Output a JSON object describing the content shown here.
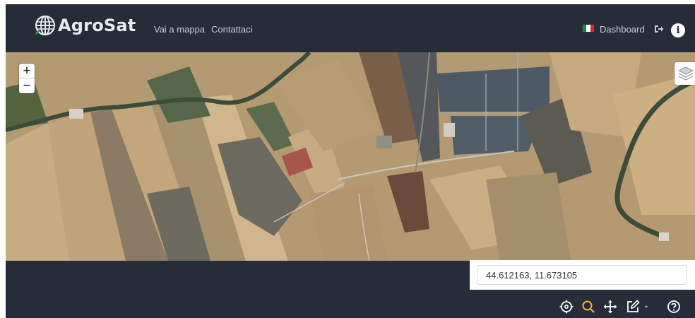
{
  "app": {
    "brand": "AgroSat"
  },
  "nav": {
    "mappa": "Vai a mappa",
    "contatti": "Contattaci",
    "dashboard": "Dashboard"
  },
  "colors": {
    "header_bg": "#262c38",
    "accent_search": "#f0b43a",
    "flag": [
      "#009246",
      "#ffffff",
      "#ce2b37"
    ]
  },
  "map": {
    "zoom_in": "+",
    "zoom_out": "−"
  },
  "coordinates": {
    "value": "44.612163, 11.673105"
  },
  "icons": {
    "brand": "globe-icon",
    "flag": "italy-flag-icon",
    "logout": "logout-icon",
    "info": "info-icon",
    "layers": "layers-icon",
    "tools": [
      "crosshair-icon",
      "search-icon",
      "move-icon",
      "edit-icon",
      "caret-up-icon",
      "help-icon"
    ]
  },
  "info_label": "i"
}
